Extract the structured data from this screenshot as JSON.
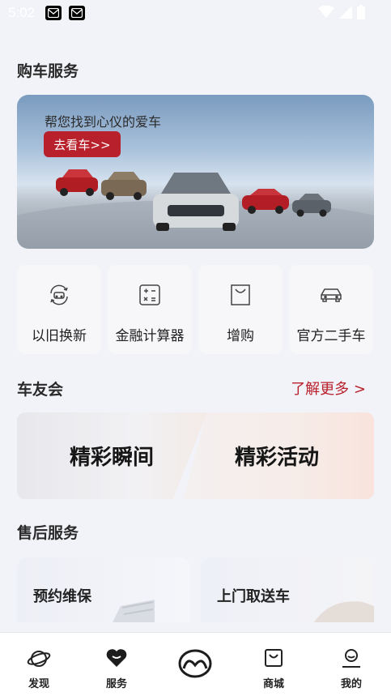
{
  "status_bar": {
    "time": "5:02"
  },
  "purchase_section": {
    "title": "购车服务",
    "banner": {
      "text": "帮您找到心仪的爱车",
      "button": "去看车>>"
    },
    "tiles": [
      {
        "label": "以旧换新",
        "icon": "trade-in-icon"
      },
      {
        "label": "金融计算器",
        "icon": "calculator-icon"
      },
      {
        "label": "增购",
        "icon": "shopping-bag-icon"
      },
      {
        "label": "官方二手车",
        "icon": "car-icon"
      }
    ]
  },
  "club_section": {
    "title": "车友会",
    "more": "了解更多 >",
    "cards": [
      "精彩瞬间",
      "精彩活动"
    ]
  },
  "after_sales_section": {
    "title": "售后服务",
    "cards": [
      "预约维保",
      "上门取送车"
    ]
  },
  "bottom_nav": [
    {
      "label": "发现",
      "icon": "planet-icon"
    },
    {
      "label": "服务",
      "icon": "heart-icon",
      "active": true
    },
    {
      "label": "",
      "icon": "mazda-logo-icon"
    },
    {
      "label": "商城",
      "icon": "shop-bag-icon"
    },
    {
      "label": "我的",
      "icon": "profile-icon"
    }
  ],
  "colors": {
    "accent": "#b8212c",
    "background": "#f2f3f8"
  }
}
